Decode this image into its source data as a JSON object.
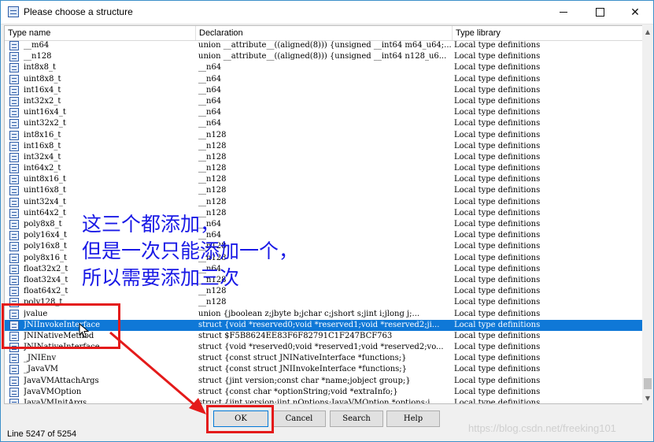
{
  "window": {
    "title": "Please choose a structure"
  },
  "columns": [
    "Type name",
    "Declaration",
    "Type library"
  ],
  "rows": [
    {
      "name": "__m64",
      "decl": "union __attribute__((aligned(8))) {unsigned __int64 m64_u64;...",
      "lib": "Local type definitions"
    },
    {
      "name": "__n128",
      "decl": "union __attribute__((aligned(8))) {unsigned __int64 n128_u6...",
      "lib": "Local type definitions"
    },
    {
      "name": "int8x8_t",
      "decl": "__n64",
      "lib": "Local type definitions"
    },
    {
      "name": "uint8x8_t",
      "decl": "__n64",
      "lib": "Local type definitions"
    },
    {
      "name": "int16x4_t",
      "decl": "__n64",
      "lib": "Local type definitions"
    },
    {
      "name": "int32x2_t",
      "decl": "__n64",
      "lib": "Local type definitions"
    },
    {
      "name": "uint16x4_t",
      "decl": "__n64",
      "lib": "Local type definitions"
    },
    {
      "name": "uint32x2_t",
      "decl": "__n64",
      "lib": "Local type definitions"
    },
    {
      "name": "int8x16_t",
      "decl": "__n128",
      "lib": "Local type definitions"
    },
    {
      "name": "int16x8_t",
      "decl": "__n128",
      "lib": "Local type definitions"
    },
    {
      "name": "int32x4_t",
      "decl": "__n128",
      "lib": "Local type definitions"
    },
    {
      "name": "int64x2_t",
      "decl": "__n128",
      "lib": "Local type definitions"
    },
    {
      "name": "uint8x16_t",
      "decl": "__n128",
      "lib": "Local type definitions"
    },
    {
      "name": "uint16x8_t",
      "decl": "__n128",
      "lib": "Local type definitions"
    },
    {
      "name": "uint32x4_t",
      "decl": "__n128",
      "lib": "Local type definitions"
    },
    {
      "name": "uint64x2_t",
      "decl": "__n128",
      "lib": "Local type definitions"
    },
    {
      "name": "poly8x8_t",
      "decl": "__n64",
      "lib": "Local type definitions"
    },
    {
      "name": "poly16x4_t",
      "decl": "__n64",
      "lib": "Local type definitions"
    },
    {
      "name": "poly16x8_t",
      "decl": "__n128",
      "lib": "Local type definitions"
    },
    {
      "name": "poly8x16_t",
      "decl": "__n128",
      "lib": "Local type definitions"
    },
    {
      "name": "float32x2_t",
      "decl": "__n64",
      "lib": "Local type definitions"
    },
    {
      "name": "float32x4_t",
      "decl": "__n128",
      "lib": "Local type definitions"
    },
    {
      "name": "float64x2_t",
      "decl": "__n128",
      "lib": "Local type definitions"
    },
    {
      "name": "poly128_t",
      "decl": "__n128",
      "lib": "Local type definitions"
    },
    {
      "name": "jvalue",
      "decl": "union {jboolean z;jbyte b;jchar c;jshort s;jint i;jlong j;...",
      "lib": "Local type definitions"
    },
    {
      "name": "JNIInvokeInterface",
      "decl": "struct {void *reserved0;void *reserved1;void *reserved2;ji...",
      "lib": "Local type definitions",
      "selected": true
    },
    {
      "name": "JNINativeMethod",
      "decl": "struct $F5B8624EE83F6F82791C1F247BCF763",
      "lib": "Local type definitions"
    },
    {
      "name": "JNINativeInterface",
      "decl": "struct {void *reserved0;void *reserved1;void *reserved2;vo...",
      "lib": "Local type definitions"
    },
    {
      "name": "_JNIEnv",
      "decl": "struct {const struct JNINativeInterface *functions;}",
      "lib": "Local type definitions"
    },
    {
      "name": "_JavaVM",
      "decl": "struct {const struct JNIInvokeInterface *functions;}",
      "lib": "Local type definitions"
    },
    {
      "name": "JavaVMAttachArgs",
      "decl": "struct {jint version;const char *name;jobject group;}",
      "lib": "Local type definitions"
    },
    {
      "name": "JavaVMOption",
      "decl": "struct {const char *optionString;void *extraInfo;}",
      "lib": "Local type definitions"
    },
    {
      "name": "JavaVMInitArgs",
      "decl": "struct {jint version;jint nOptions;JavaVMOption *options;j...",
      "lib": "Local type definitions"
    }
  ],
  "buttons": {
    "ok": "OK",
    "cancel": "Cancel",
    "search": "Search",
    "help": "Help"
  },
  "status": "Line 5247 of 5254",
  "watermark": "https://blog.csdn.net/freeking101",
  "annotation": {
    "line1": "这三个都添加，",
    "line2": "但是一次只能添加一个，",
    "line3": "所以需要添加三次"
  },
  "colors": {
    "selection": "#0f78d7",
    "annotation_text": "#1a1ae6",
    "annotation_marks": "#e41a1a"
  },
  "icons": {
    "row": "structure-table-icon",
    "title": "structure-table-icon"
  }
}
